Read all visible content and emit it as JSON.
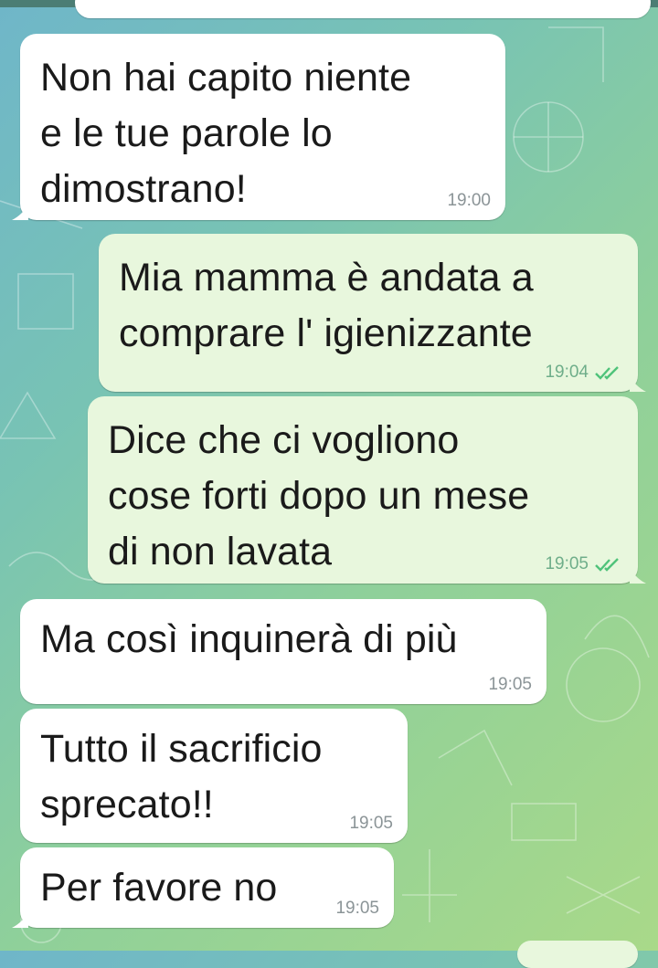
{
  "messages": [
    {
      "direction": "incoming",
      "text": "Non hai capito niente\ne le tue parole lo\ndimostrano!",
      "time": "19:00"
    },
    {
      "direction": "outgoing",
      "text": "Mia mamma è andata a\ncomprare l' igienizzante",
      "time": "19:04",
      "status": "read"
    },
    {
      "direction": "outgoing",
      "text": "Dice che ci vogliono\ncose forti dopo un mese\ndi non lavata",
      "time": "19:05",
      "status": "read"
    },
    {
      "direction": "incoming",
      "text": "Ma così inquinerà di più",
      "time": "19:05"
    },
    {
      "direction": "incoming",
      "text": "Tutto il sacrificio\nsprecato!!",
      "time": "19:05"
    },
    {
      "direction": "incoming",
      "text": "Per favore no",
      "time": "19:05"
    }
  ],
  "colors": {
    "incoming_bubble": "#ffffff",
    "outgoing_bubble": "#e8f7dd",
    "read_ticks": "#4fc37a",
    "timestamp": "#8b9497"
  },
  "icons": {
    "read_status": "double-check-icon"
  }
}
